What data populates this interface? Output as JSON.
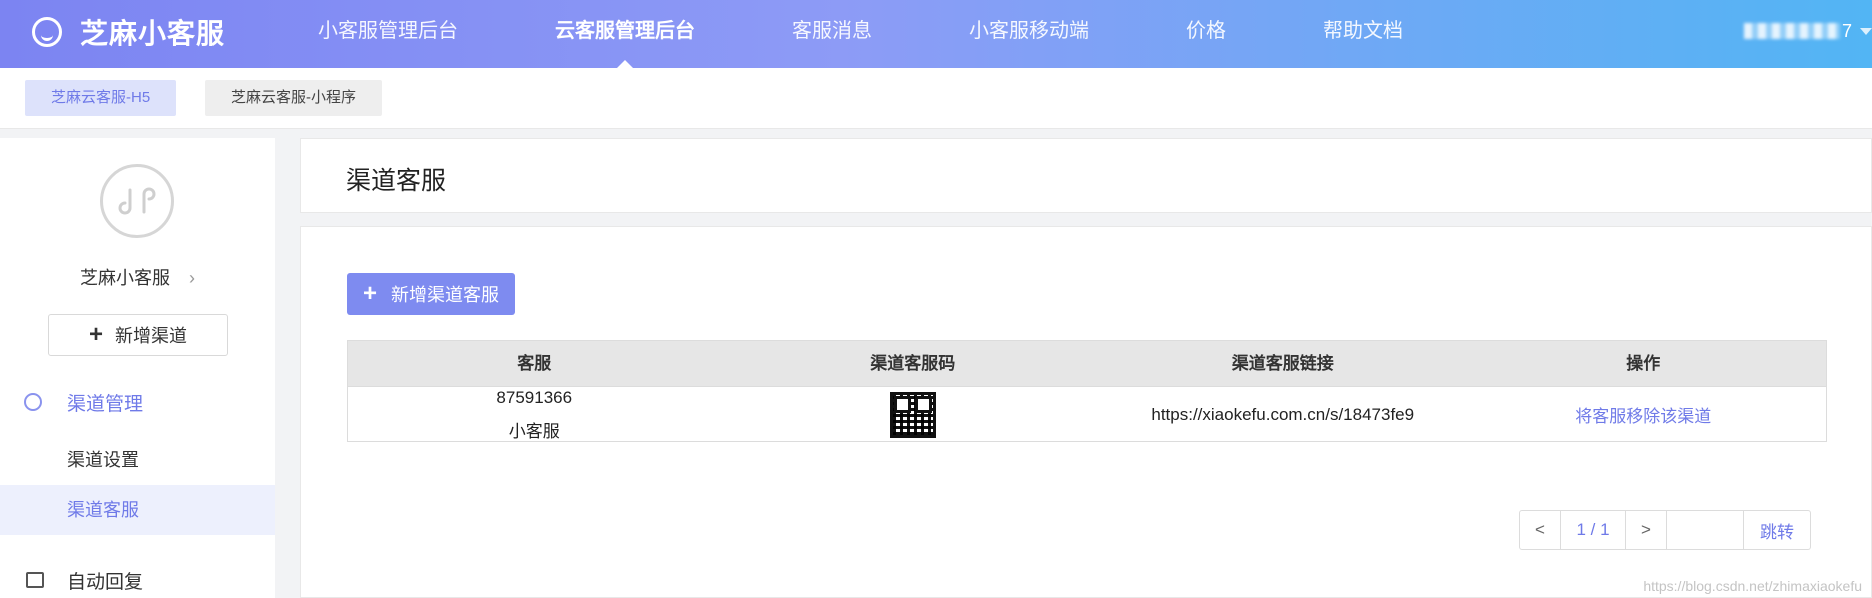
{
  "brand": {
    "name": "芝麻小客服"
  },
  "nav": {
    "items": [
      {
        "label": "小客服管理后台"
      },
      {
        "label": "云客服管理后台",
        "active": true
      },
      {
        "label": "客服消息"
      },
      {
        "label": "小客服移动端"
      },
      {
        "label": "价格"
      },
      {
        "label": "帮助文档"
      }
    ],
    "user_suffix": "7"
  },
  "channel_tabs": [
    {
      "label": "芝麻云客服-H5",
      "active": true
    },
    {
      "label": "芝麻云客服-小程序"
    }
  ],
  "sidebar": {
    "app_name": "芝麻小客服",
    "chevron": "›",
    "add_channel_icon": "+",
    "add_channel_label": "新增渠道",
    "group1_label": "渠道管理",
    "items": [
      {
        "label": "渠道设置"
      },
      {
        "label": "渠道客服",
        "active": true
      }
    ],
    "group2_label": "自动回复"
  },
  "page": {
    "title": "渠道客服"
  },
  "toolbar": {
    "add_icon": "+",
    "add_label": "新增渠道客服"
  },
  "table": {
    "headers": [
      "客服",
      "渠道客服码",
      "渠道客服链接",
      "操作"
    ],
    "rows": [
      {
        "agent_id": "87591366",
        "agent_name": "小客服",
        "link": "https://xiaokefu.com.cn/s/18473fe9",
        "action": "将客服移除该渠道"
      }
    ]
  },
  "pagination": {
    "prev": "<",
    "page": "1 / 1",
    "next": ">",
    "go": "跳转"
  },
  "watermark": "https://blog.csdn.net/zhimaxiaokefu",
  "colors": {
    "accent": "#6f7ae8",
    "button": "#7e8bf0"
  }
}
